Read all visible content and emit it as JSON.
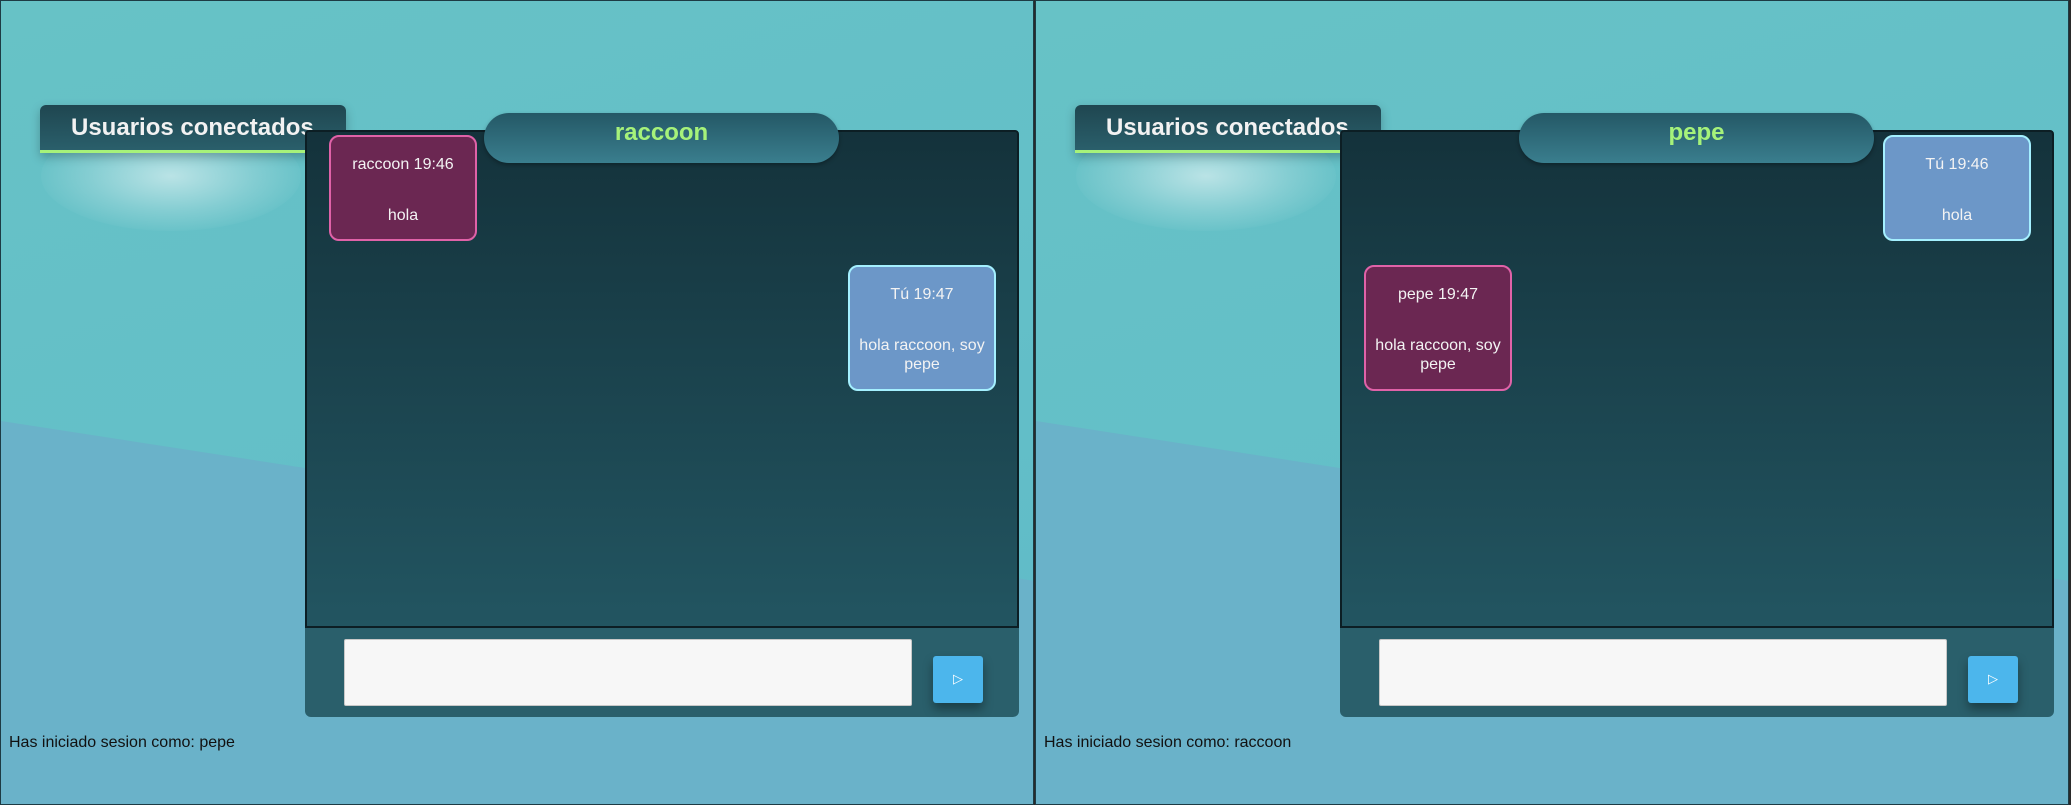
{
  "colors": {
    "accent": "#a6f27a",
    "theirs_bubble": "#6b2752",
    "mine_bubble": "#6c97c8",
    "send_button": "#4cb6ec"
  },
  "windows": [
    {
      "users_title": "Usuarios conectados",
      "chat_with": "raccoon",
      "messages": [
        {
          "from": "theirs",
          "meta": "raccoon 19:46",
          "text": "hola"
        },
        {
          "from": "mine",
          "meta": "Tú 19:47",
          "text": "hola raccoon, soy pepe"
        }
      ],
      "input_value": "",
      "send_icon": "play-icon",
      "send_label": "▷",
      "session_text": "Has iniciado sesion como: pepe"
    },
    {
      "users_title": "Usuarios conectados",
      "chat_with": "pepe",
      "messages": [
        {
          "from": "mine",
          "meta": "Tú 19:46",
          "text": "hola"
        },
        {
          "from": "theirs",
          "meta": "pepe 19:47",
          "text": "hola raccoon, soy pepe"
        }
      ],
      "input_value": "",
      "send_icon": "play-icon",
      "send_label": "▷",
      "session_text": "Has iniciado sesion como: raccoon"
    }
  ]
}
